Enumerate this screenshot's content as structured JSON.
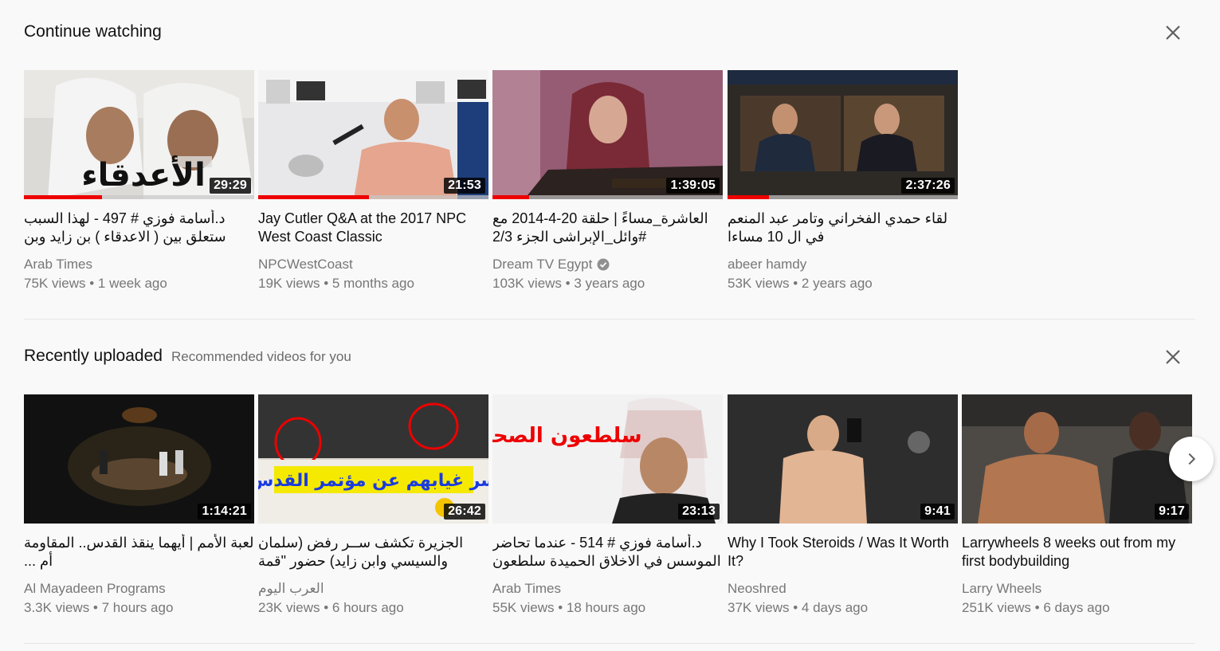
{
  "continue_watching": {
    "title": "Continue watching",
    "videos": [
      {
        "title": "د.أسامة فوزي # 497 - لهذا السبب ستعلق بين ( الاعدقاء ) بن زايد وبن راشد",
        "channel": "Arab Times",
        "views": "75K views",
        "age": "1 week ago",
        "duration": "29:29",
        "progress": 0.34,
        "overlay_text": "الأعدقاء"
      },
      {
        "title": "Jay Cutler Q&A at the 2017 NPC West Coast Classic",
        "channel": "NPCWestCoast",
        "views": "19K views",
        "age": "5 months ago",
        "duration": "21:53",
        "progress": 0.48
      },
      {
        "title": "العاشرة_مساءً | حلقة 20-4-2014 مع #وائل_الإبراشى الجزء 2/3",
        "channel": "Dream TV Egypt",
        "verified": true,
        "views": "103K views",
        "age": "3 years ago",
        "duration": "1:39:05",
        "progress": 0.16
      },
      {
        "title": "لقاء حمدي الفخراني وتامر عبد المنعم في ال 10 مساءا",
        "channel": "abeer hamdy",
        "views": "53K views",
        "age": "2 years ago",
        "duration": "2:37:26",
        "progress": 0.18
      }
    ]
  },
  "recently_uploaded": {
    "title": "Recently uploaded",
    "subtitle": "Recommended videos for you",
    "videos": [
      {
        "title": "لعبة الأمم | أيهما ينقذ القدس.. المقاومة أم ...",
        "channel": "Al Mayadeen Programs",
        "views": "3.3K views",
        "age": "7 hours ago",
        "duration": "1:14:21"
      },
      {
        "title": "الجزيرة تكشف ســر رفض (سلمان والسيسي وابن زايد) حضور \"قمة",
        "channel": "العرب اليوم",
        "views": "23K views",
        "age": "6 hours ago",
        "duration": "26:42",
        "overlay_text": "سر غيابهم عن مؤتمر القدس"
      },
      {
        "title": "د.أسامة فوزي # 514 - عندما تحاضر الموسس في الاخلاق الحميدة سلطعون",
        "channel": "Arab Times",
        "views": "55K views",
        "age": "18 hours ago",
        "duration": "23:13",
        "overlay_text": "سلطعون الصحراء"
      },
      {
        "title": "Why I Took Steroids / Was It Worth It?",
        "channel": "Neoshred",
        "views": "37K views",
        "age": "4 days ago",
        "duration": "9:41"
      },
      {
        "title": "Larrywheels 8 weeks out from my first bodybuilding",
        "channel": "Larry Wheels",
        "views": "251K views",
        "age": "6 days ago",
        "duration": "9:17"
      }
    ]
  },
  "icons": {
    "close": "close-icon",
    "next": "chevron-right-icon",
    "verified": "verified-check-icon"
  },
  "colors": {
    "progress": "#ee0000",
    "background": "#f9f9f9",
    "meta_text": "#777777"
  }
}
